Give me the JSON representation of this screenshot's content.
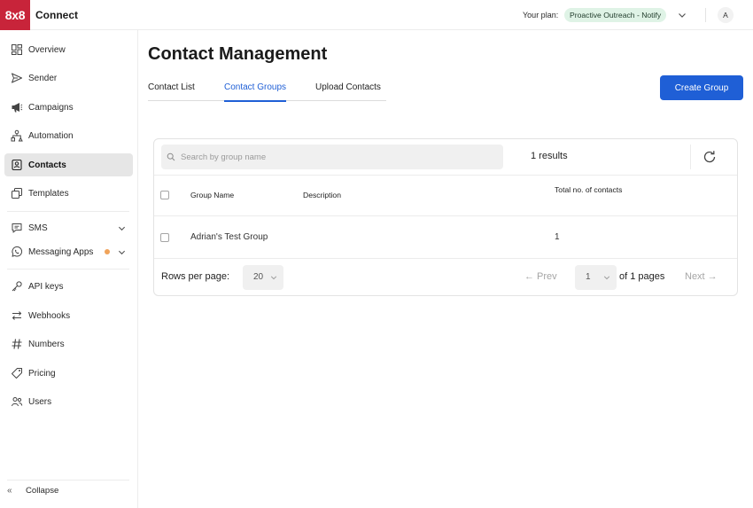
{
  "topbar": {
    "logo": "8x8",
    "brand": "Connect",
    "plan_label": "Your plan:",
    "plan_value": "Proactive Outreach - Notify",
    "avatar": "A"
  },
  "sidebar": {
    "items": [
      {
        "label": "Overview",
        "icon": "overview-icon"
      },
      {
        "label": "Sender",
        "icon": "send-icon"
      },
      {
        "label": "Campaigns",
        "icon": "megaphone-icon"
      },
      {
        "label": "Automation",
        "icon": "automation-icon"
      },
      {
        "label": "Contacts",
        "icon": "contacts-icon",
        "active": true
      },
      {
        "label": "Templates",
        "icon": "templates-icon"
      },
      {
        "label": "SMS",
        "icon": "chat-icon"
      },
      {
        "label": "Messaging Apps",
        "icon": "whatsapp-icon"
      },
      {
        "label": "API keys",
        "icon": "key-icon"
      },
      {
        "label": "Webhooks",
        "icon": "webhooks-icon"
      },
      {
        "label": "Numbers",
        "icon": "hash-icon"
      },
      {
        "label": "Pricing",
        "icon": "tag-icon"
      },
      {
        "label": "Users",
        "icon": "users-icon"
      }
    ],
    "collapse": "Collapse"
  },
  "main": {
    "title": "Contact Management",
    "tabs": [
      {
        "label": "Contact List"
      },
      {
        "label": "Contact Groups",
        "active": true
      },
      {
        "label": "Upload Contacts"
      }
    ],
    "create_button": "Create Group"
  },
  "table": {
    "search_placeholder": "Search by group name",
    "results": "1 results",
    "columns": [
      "Group Name",
      "Description",
      "Total no. of contacts"
    ],
    "rows": [
      {
        "name": "Adrian's Test Group",
        "description": "",
        "total": "1"
      }
    ],
    "rows_per_page_label": "Rows per page:",
    "rows_per_page_value": "20",
    "prev": "← Prev",
    "page_value": "1",
    "of_pages": "of 1 pages",
    "next": "Next →"
  },
  "colors": {
    "accent": "#1f5fd6",
    "brand": "#c8243a",
    "plan_pill": "#dff3e6",
    "status_dot": "#f0a35a"
  }
}
